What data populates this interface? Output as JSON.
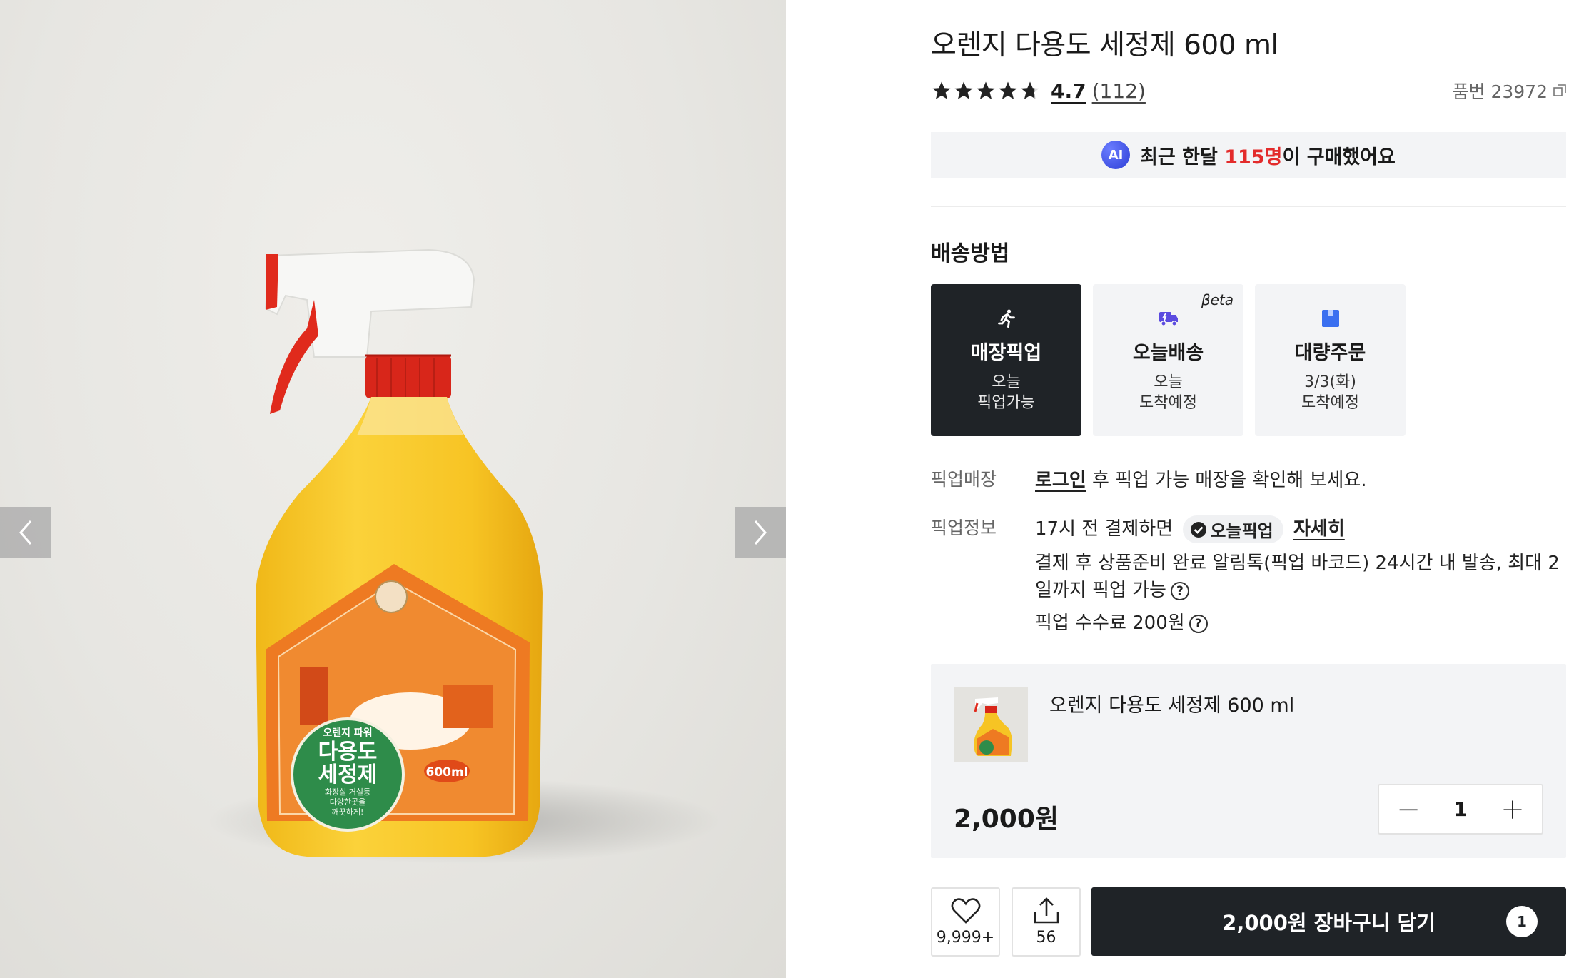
{
  "gallery": {
    "prev_icon": "chevron-left-icon",
    "next_icon": "chevron-right-icon"
  },
  "product": {
    "title": "오렌지 다용도 세정제 600 ml",
    "rating": "4.7",
    "rating_value": 4.7,
    "review_count": "(112)",
    "sku": "품번 23972",
    "label": {
      "top": "오렌지 파워",
      "line1": "다용도",
      "line2": "세정제",
      "desc1": "화장실 거실등",
      "desc2": "다양한곳을",
      "desc3": "깨끗하게!",
      "volume": "600ml"
    }
  },
  "ai_banner": {
    "badge": "AI",
    "pre": "최근 한달 ",
    "highlight": "115명",
    "post": "이 구매했어요"
  },
  "shipping": {
    "title": "배송방법",
    "options": [
      {
        "name": "매장픽업",
        "line1": "오늘",
        "line2": "픽업가능",
        "icon": "running-person-icon",
        "selected": true
      },
      {
        "name": "오늘배송",
        "line1": "오늘",
        "line2": "도착예정",
        "icon": "delivery-truck-icon",
        "badge": "βeta"
      },
      {
        "name": "대량주문",
        "line1": "3/3(화)",
        "line2": "도착예정",
        "icon": "box-icon"
      }
    ]
  },
  "pickup": {
    "store_label": "픽업매장",
    "login_link": "로그인",
    "store_text": " 후 픽업 가능 매장을 확인해 보세요.",
    "info_label": "픽업정보",
    "info_pre": "17시 전 결제하면",
    "pill": "오늘픽업",
    "detail_link": "자세히",
    "line2a": "결제 후 상품준비 완료 알림톡(픽업 바코드) 24시간 내 발송, 최대 2",
    "line2b": "일까지 픽업 가능",
    "fee": "픽업 수수료 200원",
    "help": "?"
  },
  "cart": {
    "name": "오렌지 다용도 세정제 600 ml",
    "price": "2,000원",
    "quantity": "1",
    "minus": "−",
    "plus": "+"
  },
  "actions": {
    "likes": "9,999+",
    "shares": "56",
    "buy_label": "2,000원 장바구니 담기",
    "cart_count": "1"
  },
  "colors": {
    "dark": "#1f2327",
    "highlight": "#e32b2b",
    "accent": "#2e3fd6",
    "panel": "#f3f4f6"
  }
}
